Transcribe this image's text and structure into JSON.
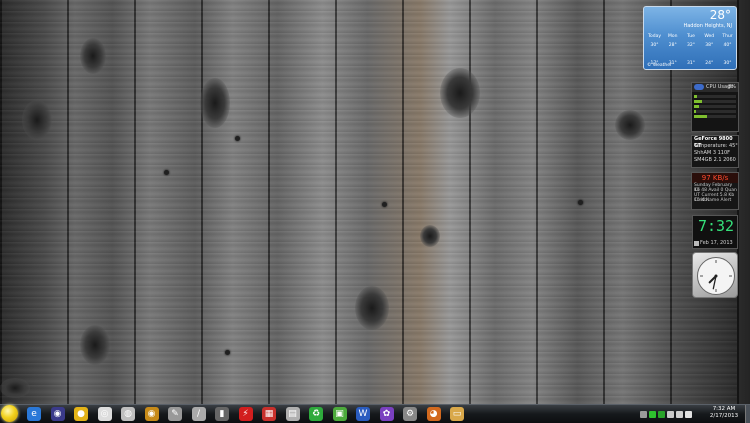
{
  "weather": {
    "temperature": "28°",
    "location": "Haddon Heights, NJ",
    "days": [
      "Today",
      "Mon",
      "Tue",
      "Wed",
      "Thur"
    ],
    "highs": [
      "30°",
      "28°",
      "32°",
      "38°",
      "40°"
    ],
    "lows": [
      "17°",
      "31°",
      "31°",
      "24°",
      "30°"
    ],
    "footer": "© Weather"
  },
  "cpu_gadget": {
    "title": "CPU Usage",
    "percent": "8%",
    "bar_levels": [
      0.08,
      0.2,
      0.12,
      0.05,
      0.3
    ],
    "accent": "#7fbf2f"
  },
  "gpu_gadget": {
    "title": "GeForce 9800 GT",
    "subtitle": "Temperature: 45°",
    "row1": "ShhAM 3 110F",
    "row2": "SM4GB 2.1 2060"
  },
  "net_gadget": {
    "headline": "97 KB/s",
    "row1": "Sunday February 17",
    "row2": "Kb 48 Avail 0 Quan",
    "row3": "UT Current 5.8 Kb 15 Kb",
    "row4": "Cmd Name Alert",
    "headline_color": "#ff4a2e"
  },
  "digital_clock": {
    "time": "7:32",
    "date": "Feb 17, 2013",
    "color": "#35e07a"
  },
  "analog_clock": {
    "hour_hand_angle": 225,
    "minute_hand_angle": 192
  },
  "taskbar": {
    "start_icon": "smiley-start-orb-icon",
    "pinned": [
      {
        "name": "ie-icon",
        "color": "#2a78d8",
        "glyph": "e"
      },
      {
        "name": "eye-icon",
        "color": "#3a3a8a",
        "glyph": "◉"
      },
      {
        "name": "yellow-disc-icon",
        "color": "#e3b318",
        "glyph": "●"
      },
      {
        "name": "media-disc-icon",
        "color": "#ddd",
        "glyph": "◎"
      },
      {
        "name": "cd-icon",
        "color": "#bfbfbf",
        "glyph": "◍"
      },
      {
        "name": "speaker-icon",
        "color": "#c78a18",
        "glyph": "◉"
      },
      {
        "name": "wand-icon",
        "color": "#999",
        "glyph": "✎"
      },
      {
        "name": "pen-tool-icon",
        "color": "#aaa",
        "glyph": "/"
      },
      {
        "name": "film-icon",
        "color": "#666",
        "glyph": "▮"
      },
      {
        "name": "lightning-icon",
        "color": "#d21e1e",
        "glyph": "⚡"
      },
      {
        "name": "red-app-icon",
        "color": "#c8302c",
        "glyph": "▦"
      },
      {
        "name": "calendar-icon",
        "color": "#b0b0b0",
        "glyph": "▤"
      },
      {
        "name": "recycle-icon",
        "color": "#2eaa3c",
        "glyph": "♻"
      },
      {
        "name": "chat-icon",
        "color": "#4caa3c",
        "glyph": "▣"
      },
      {
        "name": "word-icon",
        "color": "#2a5cc0",
        "glyph": "W"
      },
      {
        "name": "palette-icon",
        "color": "#7a40c0",
        "glyph": "✿"
      },
      {
        "name": "gear-icon",
        "color": "#888",
        "glyph": "⚙"
      },
      {
        "name": "firefox-icon",
        "color": "#d2691e",
        "glyph": "◕"
      },
      {
        "name": "folder-icon",
        "color": "#d9a84a",
        "glyph": "▭"
      }
    ],
    "clock_time": "7:32 AM",
    "clock_date": "2/17/2013"
  }
}
